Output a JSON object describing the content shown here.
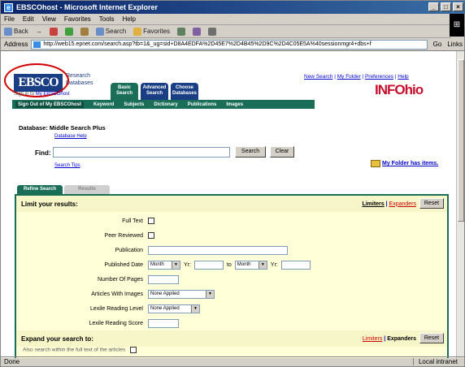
{
  "window": {
    "title": "EBSCOhost - Microsoft Internet Explorer",
    "controls": [
      "_",
      "□",
      "×"
    ]
  },
  "menu": [
    "File",
    "Edit",
    "View",
    "Favorites",
    "Tools",
    "Help"
  ],
  "toolbar": {
    "back": "Back",
    "forward": "→",
    "search": "Search",
    "favorites": "Favorites",
    "history": "History"
  },
  "address": {
    "label": "Address",
    "url": "http://web15.epnet.com/search.asp?tb=1&_ug=sid+D8A4EDFA%2D45E7%2D4B45%2D9C%2D4C05E5A%40sessionmgr4+dbs+f",
    "go": "Go",
    "links": "Links"
  },
  "site": {
    "logo": "EBSCO",
    "logo_sub": "HOST",
    "slogan": [
      "Research",
      "Databases"
    ],
    "host_text": "Sign in to",
    "host_link": "My EBSCOhost",
    "top_tabs": [
      {
        "label": "Basic Search",
        "color": "green"
      },
      {
        "label": "Advanced Search",
        "color": "blue"
      },
      {
        "label": "Choose Databases",
        "color": "blue"
      }
    ],
    "green_links": [
      "Sign Out of My EBSCOhost",
      "Keyword",
      "Subjects",
      "Publications",
      "Images",
      "Dictionary"
    ],
    "top_links": [
      "New Search",
      "My Folder",
      "Preferences",
      "Help"
    ],
    "brand": "INFOhio"
  },
  "search": {
    "database_label": "Database: Middle Search Plus",
    "database_help": "Database Help",
    "find_label": "Find:",
    "find_value": "",
    "search_btn": "Search",
    "clear_btn": "Clear",
    "search_tips": "Search Tips",
    "folder_text": "My Folder has items."
  },
  "subtabs": {
    "refine": "Refine Search",
    "results": "Results"
  },
  "limits": {
    "heading": "Limit your results:",
    "limiters": "Limiters",
    "expanders": "Expanders",
    "reset": "Reset",
    "full_text": "Full Text",
    "peer_reviewed": "Peer Reviewed",
    "publication": "Publication",
    "published_date": "Published Date",
    "month": "Month",
    "yr": "Yr:",
    "to": "to",
    "number_of_pages": "Number Of Pages",
    "articles_with_images": "Articles With Images",
    "articles_with_images_value": "None Applied",
    "lexile_level": "Lexile Reading Level",
    "lexile_level_value": "None Applied",
    "lexile_score": "Lexile Reading Score"
  },
  "expand": {
    "heading": "Expand your search to:",
    "limiters": "Limiters",
    "expanders": "Expanders",
    "reset": "Reset",
    "also_search": "Also search within the full text of the articles"
  },
  "status": {
    "left": "Done",
    "zone": "Local intranet"
  }
}
